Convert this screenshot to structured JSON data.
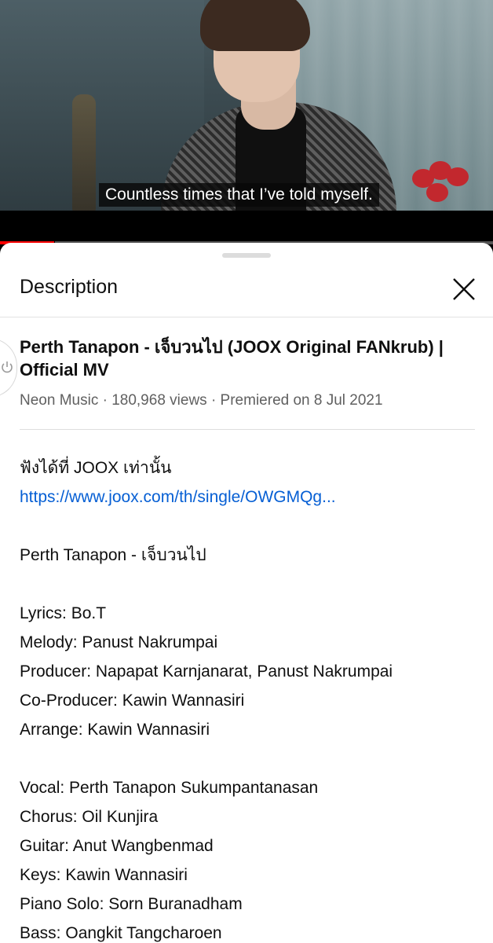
{
  "video": {
    "subtitle": "Countless times that I’ve told myself.",
    "progress_fraction": 0.11
  },
  "sheet": {
    "title": "Description",
    "close_icon": "close-icon"
  },
  "info": {
    "title": "Perth Tanapon - เจ็บวนไป (JOOX Original FANkrub) | Official MV",
    "meta": "Neon Music · 180,968 views · Premiered on 8 Jul 2021"
  },
  "description": {
    "listen_line": "ฟังได้ที่ JOOX เท่านั้น",
    "link": "https://www.joox.com/th/single/OWGMQg...",
    "song_line": "Perth Tanapon - เจ็บวนไป",
    "credits_1": [
      "Lyrics: Bo.T",
      "Melody: Panust Nakrumpai",
      "Producer: Napapat Karnjanarat, Panust Nakrumpai",
      "Co-Producer: Kawin Wannasiri",
      "Arrange: Kawin Wannasiri"
    ],
    "credits_2": [
      "Vocal: Perth Tanapon Sukumpantanasan",
      "Chorus: Oil Kunjira",
      "Guitar: Anut Wangbenmad",
      "Keys: Kawin Wannasiri",
      "Piano Solo: Sorn Buranadham",
      "Bass: Oangkit Tangcharoen"
    ]
  }
}
